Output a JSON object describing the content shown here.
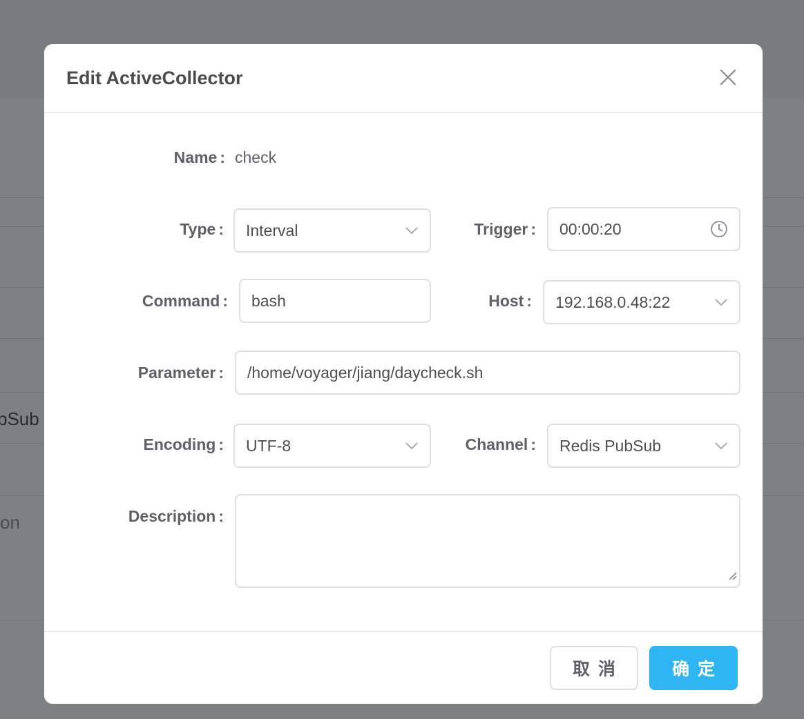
{
  "background": {
    "partial_text_1": "bSub",
    "partial_text_2": "on"
  },
  "dialog": {
    "title": "Edit ActiveCollector",
    "fields": {
      "name": {
        "label": "Name",
        "value": "check"
      },
      "type": {
        "label": "Type",
        "value": "Interval"
      },
      "trigger": {
        "label": "Trigger",
        "value": "00:00:20"
      },
      "command": {
        "label": "Command",
        "value": "bash"
      },
      "host": {
        "label": "Host",
        "value": "192.168.0.48:22"
      },
      "parameter": {
        "label": "Parameter",
        "value": "/home/voyager/jiang/daycheck.sh"
      },
      "encoding": {
        "label": "Encoding",
        "value": "UTF-8"
      },
      "channel": {
        "label": "Channel",
        "value": "Redis PubSub"
      },
      "description": {
        "label": "Description",
        "value": ""
      }
    },
    "colon": ":",
    "buttons": {
      "cancel": "取消",
      "confirm": "确定"
    }
  },
  "colors": {
    "overlay": "#7f8082",
    "primary": "#2eb5f2",
    "border": "#dcdfe6"
  },
  "icons": [
    "close-icon",
    "chevron-down-icon",
    "clock-icon",
    "resize-grip-icon"
  ]
}
